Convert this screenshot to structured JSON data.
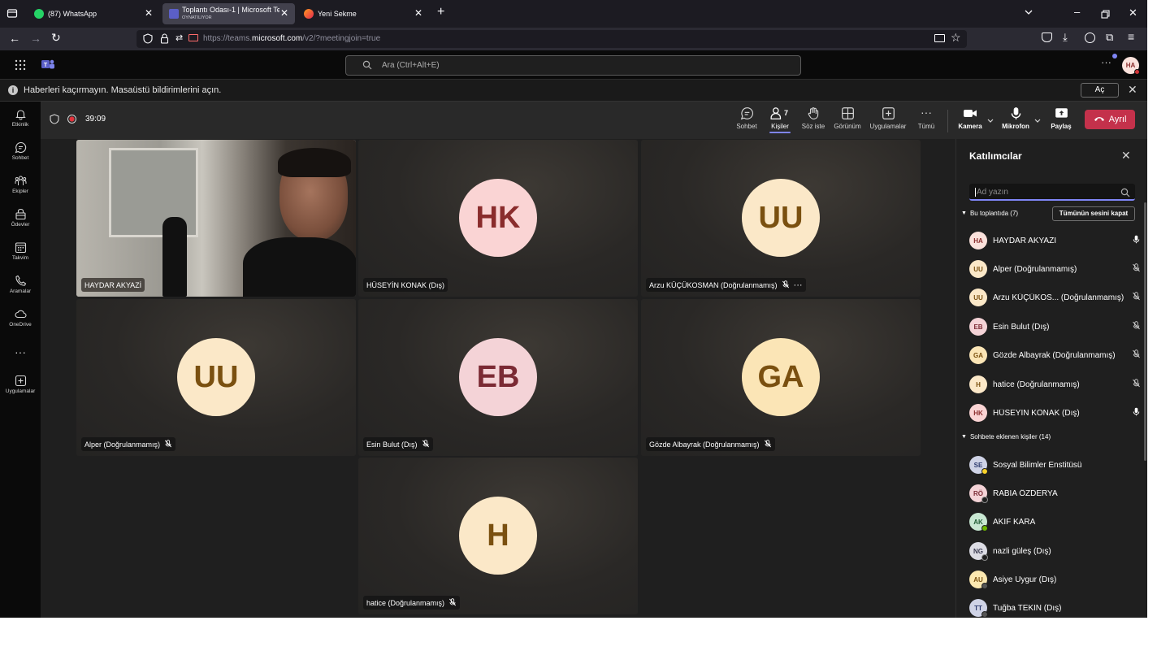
{
  "browser": {
    "tabs": [
      {
        "title": "(87) WhatsApp"
      },
      {
        "title": "Toplantı Odası-1 | Microsoft Tea",
        "subtitle": "OYNATILIYOR"
      },
      {
        "title": "Yeni Sekme"
      }
    ],
    "url_prefix": "https://teams.",
    "url_domain": "microsoft.com",
    "url_path": "/v2/?meetingjoin=true"
  },
  "teams": {
    "search_placeholder": "Ara (Ctrl+Alt+E)",
    "profile_initials": "HA"
  },
  "notification": {
    "text": "Haberleri kaçırmayın. Masaüstü bildirimlerini açın.",
    "button": "Aç"
  },
  "rail": [
    {
      "label": "Etkinlik",
      "icon": "bell-icon"
    },
    {
      "label": "Sohbet",
      "icon": "chat-icon"
    },
    {
      "label": "Ekipler",
      "icon": "teams-icon"
    },
    {
      "label": "Ödevler",
      "icon": "assignments-icon"
    },
    {
      "label": "Takvim",
      "icon": "calendar-icon"
    },
    {
      "label": "Aramalar",
      "icon": "phone-icon"
    },
    {
      "label": "OneDrive",
      "icon": "cloud-icon"
    },
    {
      "label": "Uygulamalar",
      "icon": "add-apps-icon"
    }
  ],
  "meeting": {
    "timer": "39:09",
    "people_count": "7",
    "toolbar": {
      "chat": "Sohbet",
      "people": "Kişiler",
      "raise": "Söz iste",
      "view": "Görünüm",
      "apps": "Uygulamalar",
      "more": "Tümü",
      "camera": "Kamera",
      "mic": "Mikrofon",
      "share": "Paylaş",
      "leave": "Ayrıl"
    },
    "tiles": [
      {
        "name": "HAYDAR AKYAZİ",
        "initials": "",
        "video": true
      },
      {
        "name": "HÜSEYİN KONAK (Dış)",
        "initials": "HK"
      },
      {
        "name": "Arzu KÜÇÜKOSMAN (Doğrulanmamış)",
        "initials": "UU"
      },
      {
        "name": "Alper (Doğrulanmamış)",
        "initials": "UU"
      },
      {
        "name": "Esin Bulut (Dış)",
        "initials": "EB"
      },
      {
        "name": "Gözde Albayrak (Doğrulanmamış)",
        "initials": "GA"
      },
      {
        "name": "hatice (Doğrulanmamış)",
        "initials": "H"
      }
    ]
  },
  "panel": {
    "title": "Katılımcılar",
    "search_placeholder": "Ad yazın",
    "section1": "Bu toplantıda (7)",
    "mute_all": "Tümünün sesini kapat",
    "in_meeting": [
      {
        "initials": "HA",
        "name": "HAYDAR AKYAZİ",
        "mic": "on"
      },
      {
        "initials": "UU",
        "name": "Alper (Doğrulanmamış)",
        "mic": "off"
      },
      {
        "initials": "UU",
        "name": "Arzu KÜÇÜKOS... (Doğrulanmamış)",
        "mic": "off"
      },
      {
        "initials": "EB",
        "name": "Esin Bulut (Dış)",
        "mic": "off"
      },
      {
        "initials": "GA",
        "name": "Gözde Albayrak (Doğrulanmamış)",
        "mic": "off"
      },
      {
        "initials": "H",
        "name": "hatice (Doğrulanmamış)",
        "mic": "off"
      },
      {
        "initials": "HK",
        "name": "HÜSEYİN KONAK (Dış)",
        "mic": "on"
      }
    ],
    "section2": "Sohbete eklenen kişiler (14)",
    "in_chat": [
      {
        "initials": "SE",
        "name": "Sosyal Bilimler Enstitüsü"
      },
      {
        "initials": "RÖ",
        "name": "RABİA ÖZDERYA"
      },
      {
        "initials": "AK",
        "name": "AKİF KARA"
      },
      {
        "initials": "NG",
        "name": "nazli güleş (Dış)"
      },
      {
        "initials": "AU",
        "name": "Asiye Uygur (Dış)"
      },
      {
        "initials": "TT",
        "name": "Tuğba TEKİN (Dış)"
      }
    ]
  },
  "colors": {
    "accent": "#7f85f5",
    "leave": "#c4314b"
  }
}
